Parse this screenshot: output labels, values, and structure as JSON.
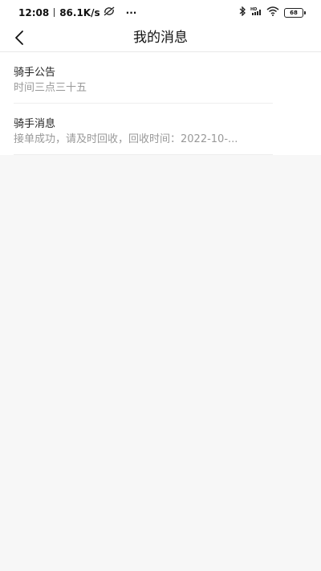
{
  "status_bar": {
    "time": "12:08",
    "speed": "86.1K/s",
    "more": "···",
    "battery": "68"
  },
  "header": {
    "title": "我的消息"
  },
  "messages": [
    {
      "title": "骑手公告",
      "subtitle": "时间三点三十五"
    },
    {
      "title": "骑手消息",
      "subtitle": "接单成功，请及时回收，回收时间：2022-10-..."
    }
  ]
}
